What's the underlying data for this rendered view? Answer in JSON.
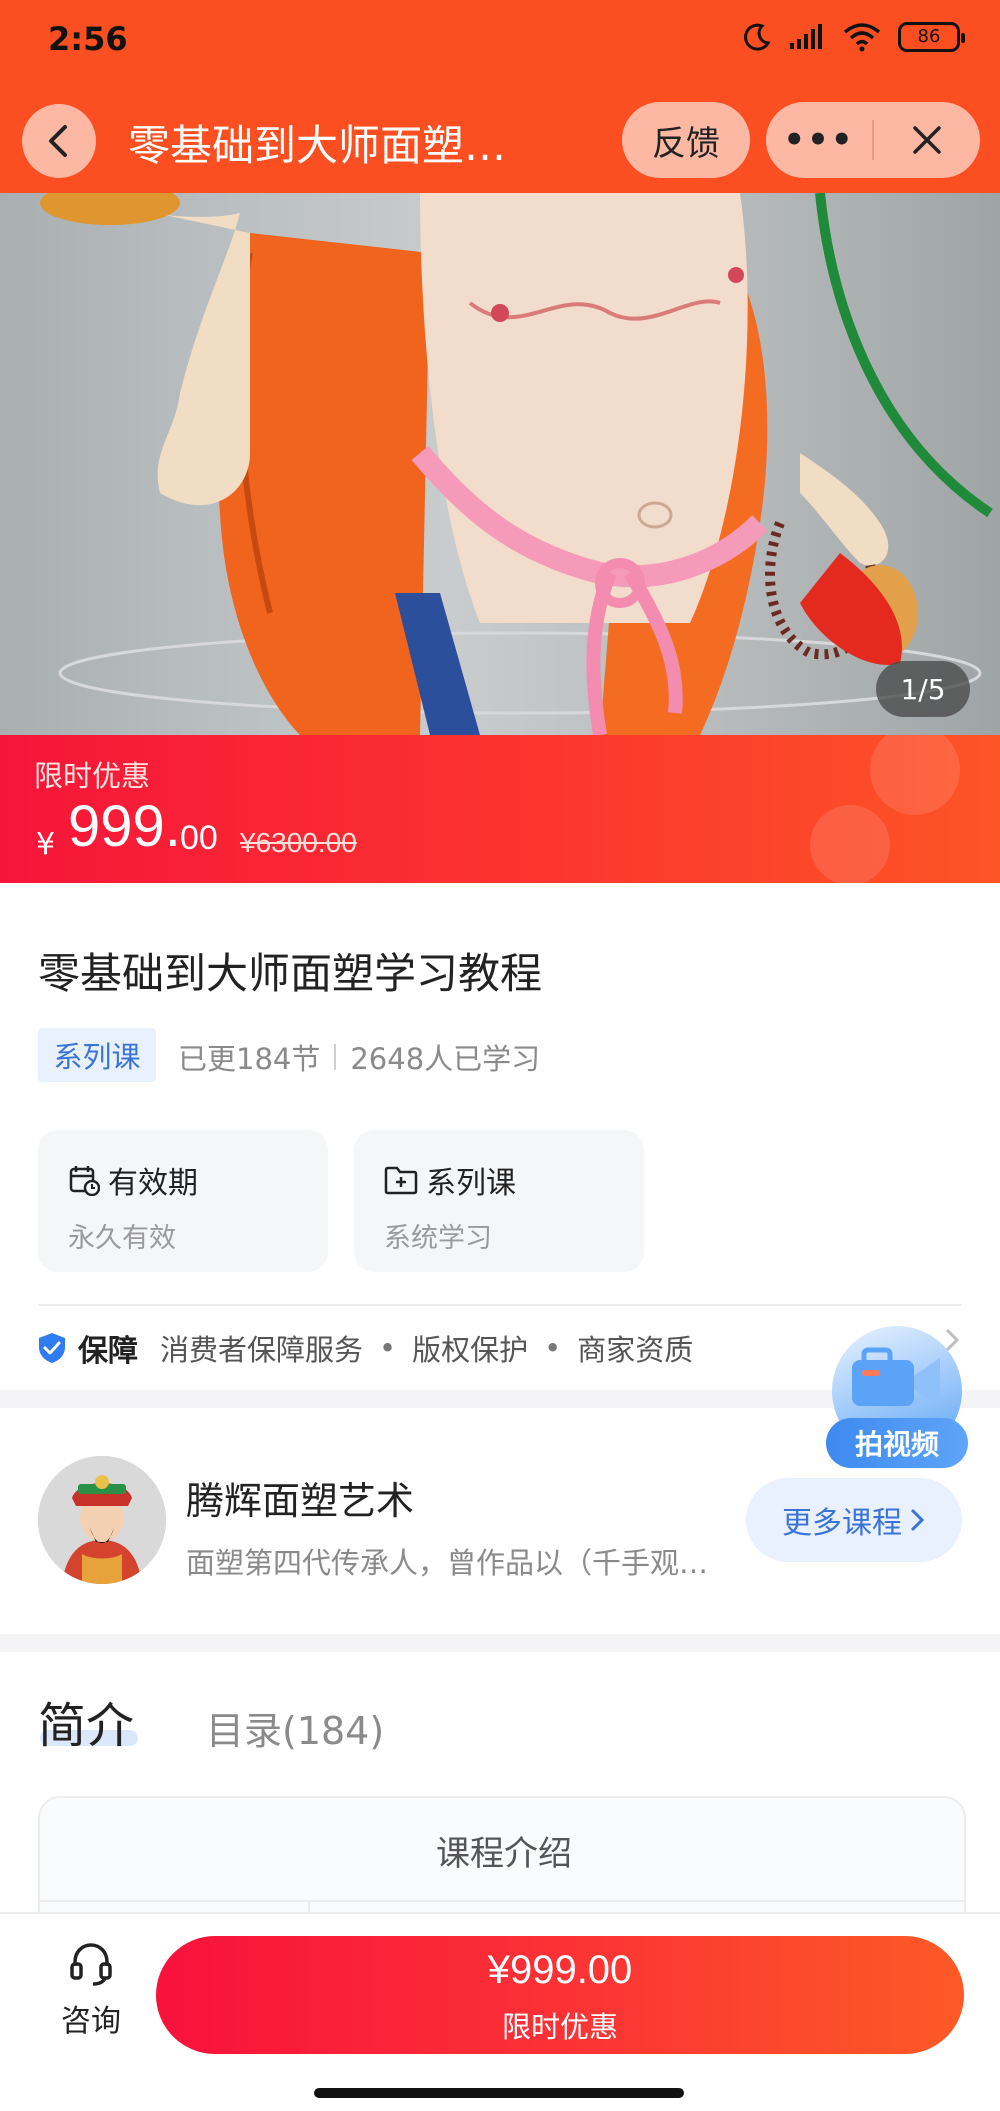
{
  "status_bar": {
    "time": "2:56",
    "battery": "86"
  },
  "header": {
    "title": "零基础到大师面塑…",
    "feedback_label": "反馈",
    "more_label": "•••"
  },
  "hero": {
    "counter": "1/5"
  },
  "price_banner": {
    "promo_label": "限时优惠",
    "currency": "¥",
    "price_integer": "999.",
    "price_decimal": "00",
    "original_price": "¥6300.00"
  },
  "course": {
    "title": "零基础到大师面塑学习教程",
    "tag": "系列课",
    "updated": "已更184节",
    "learners": "2648人已学习",
    "cards": [
      {
        "title": "有效期",
        "subtitle": "永久有效"
      },
      {
        "title": "系列课",
        "subtitle": "系统学习"
      }
    ]
  },
  "guarantee": {
    "title": "保障",
    "items": [
      "消费者保障服务",
      "版权保护",
      "商家资质"
    ]
  },
  "float_badge": {
    "label": "拍视频"
  },
  "author": {
    "name": "腾辉面塑艺术",
    "description": "面塑第四代传承人，曾作品以（千手观…",
    "more_label": "更多课程"
  },
  "tabs": {
    "intro": "简介",
    "catalog": "目录(184)"
  },
  "intro_box": {
    "heading": "课程介绍"
  },
  "bottom_bar": {
    "consult_label": "咨询",
    "buy_price": "¥999.00",
    "buy_label": "限时优惠"
  },
  "colors": {
    "header_bg": "#fb4f22",
    "price_red": "#f6153a",
    "accent_blue": "#3b74d8"
  }
}
